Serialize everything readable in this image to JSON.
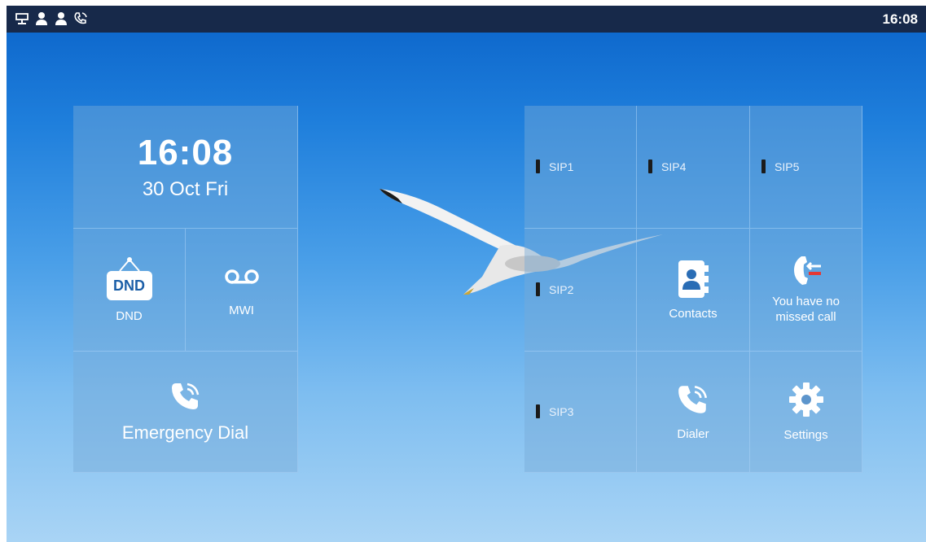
{
  "statusbar": {
    "icons": [
      "network-icon",
      "account-icon",
      "account-icon",
      "call-forward-icon"
    ],
    "time": "16:08"
  },
  "clock": {
    "time": "16:08",
    "date": "30 Oct Fri"
  },
  "dnd": {
    "badge": "DND",
    "label": "DND"
  },
  "mwi": {
    "label": "MWI"
  },
  "emergency": {
    "label": "Emergency Dial"
  },
  "sip_lines": [
    "SIP1",
    "SIP4",
    "SIP5",
    "SIP2",
    "SIP3"
  ],
  "contacts": {
    "label": "Contacts"
  },
  "missed": {
    "line1": "You have no",
    "line2": "missed call"
  },
  "dialer": {
    "label": "Dialer"
  },
  "settings": {
    "label": "Settings"
  },
  "colors": {
    "statusbar": "#17294a",
    "missed_call_accent": "#e53935"
  }
}
